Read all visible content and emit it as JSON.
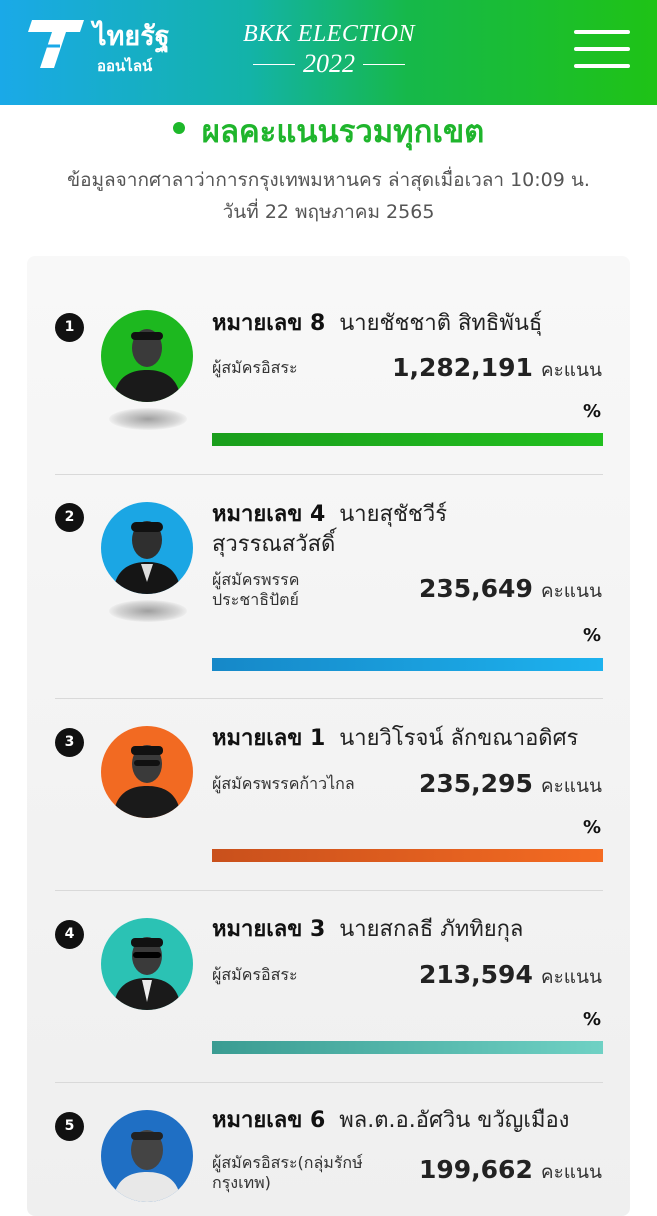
{
  "header": {
    "logo_text": "ไทยรัฐ",
    "logo_sub": "ออนไลน์",
    "election_line1": "BKK ELECTION",
    "election_line2": "2022",
    "menu_icon": "hamburger-menu-icon"
  },
  "page": {
    "title": "ผลคะแนนรวมทุกเขต",
    "subtitle_line1": "ข้อมูลจากศาลาว่าการกรุงเทพมหานคร ล่าสุดเมื่อเวลา 10:09 น.",
    "subtitle_line2": "วันที่ 22 พฤษภาคม 2565"
  },
  "colors": {
    "header_start": "#1aa9e8",
    "header_end": "#1fc316",
    "title_green": "#1fb52c"
  },
  "candidates": [
    {
      "rank": "1",
      "number_label": "หมายเลข 8",
      "name": "นายชัชชาติ สิทธิพันธุ์",
      "party": "ผู้สมัครอิสระ",
      "votes": "1,282,191",
      "unit": "คะแนน",
      "pct": "%",
      "color": "#1da81f",
      "bar_fraction": 1.0
    },
    {
      "rank": "2",
      "number_label": "หมายเลข 4",
      "name": "นายสุชัชวีร์ สุวรรณสวัสดิ์",
      "party": "ผู้สมัครพรรคประชาธิปัตย์",
      "votes": "235,649",
      "unit": "คะแนน",
      "pct": "%",
      "color": "#1ba6e4",
      "bar_fraction": 1.0
    },
    {
      "rank": "3",
      "number_label": "หมายเลข 1",
      "name": "นายวิโรจน์ ลักขณาอดิศร",
      "party": "ผู้สมัครพรรคก้าวไกล",
      "votes": "235,295",
      "unit": "คะแนน",
      "pct": "%",
      "color": "#f26a22",
      "bar_fraction": 1.0
    },
    {
      "rank": "4",
      "number_label": "หมายเลข 3",
      "name": "นายสกลธี ภัททิยกุล",
      "party": "ผู้สมัครอิสระ",
      "votes": "213,594",
      "unit": "คะแนน",
      "pct": "%",
      "color": "#2bc2b4",
      "bar_fraction": 1.0
    },
    {
      "rank": "5",
      "number_label": "หมายเลข 6",
      "name": "พล.ต.อ.อัศวิน ขวัญเมือง",
      "party": "ผู้สมัครอิสระ(กลุ่มรักษ์กรุงเทพ)",
      "votes": "199,662",
      "unit": "คะแนน",
      "pct": "%",
      "color": "#1f6fc4",
      "bar_fraction": 1.0
    }
  ]
}
